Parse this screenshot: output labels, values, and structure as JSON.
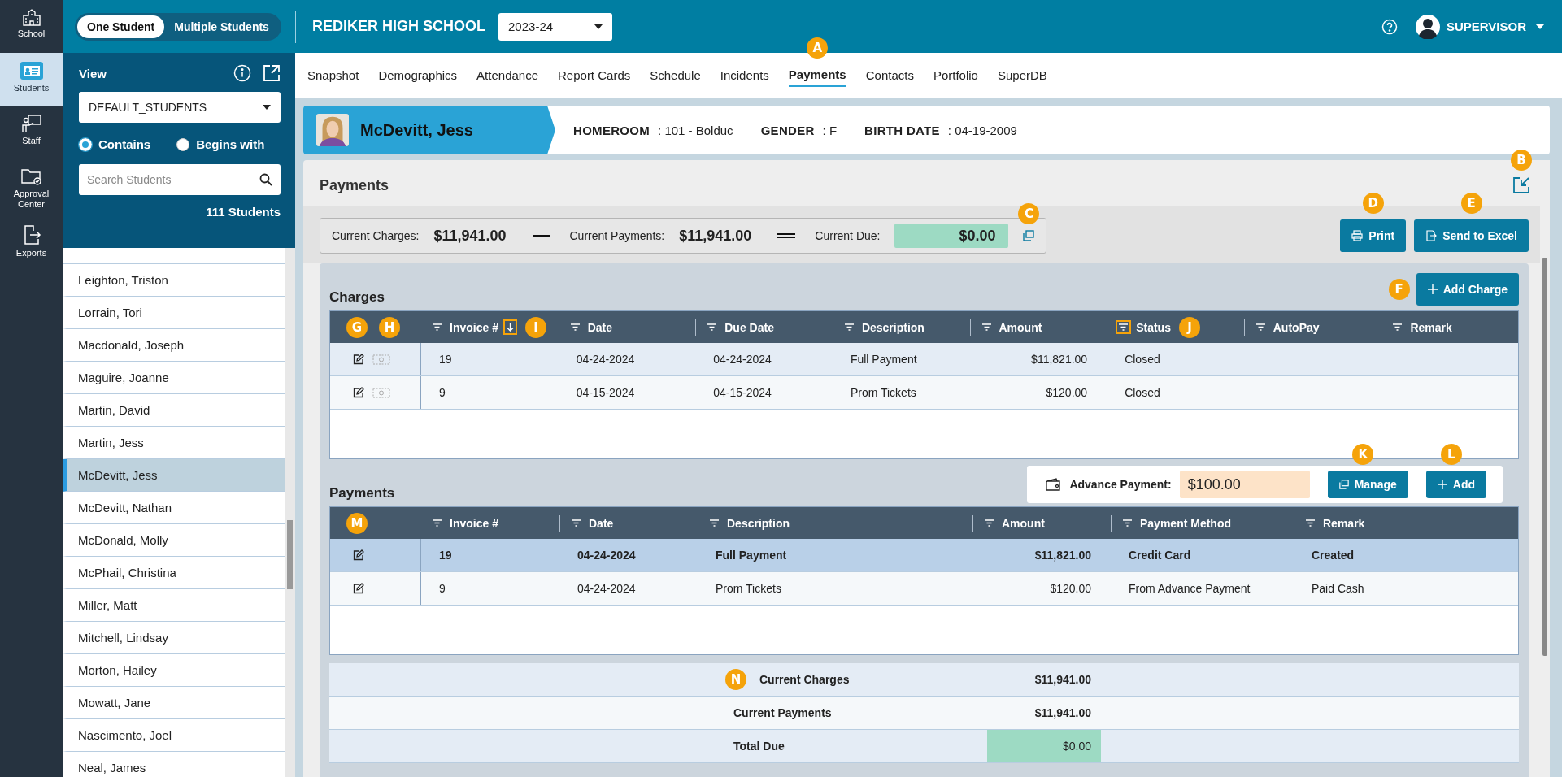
{
  "rail": [
    {
      "label": "School",
      "selected": false
    },
    {
      "label": "Students",
      "selected": true
    },
    {
      "label": "Staff",
      "selected": false
    },
    {
      "label": "Approval Center",
      "selected": false
    },
    {
      "label": "Exports",
      "selected": false
    }
  ],
  "mode_toggle": [
    {
      "label": "One Student",
      "selected": true
    },
    {
      "label": "Multiple Students",
      "selected": false
    }
  ],
  "school": "REDIKER HIGH SCHOOL",
  "year": "2023-24",
  "user": "SUPERVISOR",
  "sidebar": {
    "view_label": "View",
    "view_value": "DEFAULT_STUDENTS",
    "match": [
      {
        "label": "Contains",
        "selected": true
      },
      {
        "label": "Begins with",
        "selected": false
      }
    ],
    "search": {
      "placeholder": "Search Students"
    },
    "count": "111 Students",
    "students": [
      {
        "name": "Leighton, Triston",
        "selected": false
      },
      {
        "name": "Lorrain, Tori",
        "selected": false
      },
      {
        "name": "Macdonald, Joseph",
        "selected": false
      },
      {
        "name": "Maguire, Joanne",
        "selected": false
      },
      {
        "name": "Martin, David",
        "selected": false
      },
      {
        "name": "Martin, Jess",
        "selected": false
      },
      {
        "name": "McDevitt, Jess",
        "selected": true
      },
      {
        "name": "McDevitt, Nathan",
        "selected": false
      },
      {
        "name": "McDonald, Molly",
        "selected": false
      },
      {
        "name": "McPhail, Christina",
        "selected": false
      },
      {
        "name": "Miller, Matt",
        "selected": false
      },
      {
        "name": "Mitchell, Lindsay",
        "selected": false
      },
      {
        "name": "Morton, Hailey",
        "selected": false
      },
      {
        "name": "Mowatt, Jane",
        "selected": false
      },
      {
        "name": "Nascimento, Joel",
        "selected": false
      },
      {
        "name": "Neal, James",
        "selected": false
      }
    ]
  },
  "tabs": [
    {
      "label": "Snapshot",
      "selected": false
    },
    {
      "label": "Demographics",
      "selected": false
    },
    {
      "label": "Attendance",
      "selected": false
    },
    {
      "label": "Report Cards",
      "selected": false
    },
    {
      "label": "Schedule",
      "selected": false
    },
    {
      "label": "Incidents",
      "selected": false
    },
    {
      "label": "Payments",
      "selected": true,
      "callout": "A"
    },
    {
      "label": "Contacts",
      "selected": false
    },
    {
      "label": "Portfolio",
      "selected": false
    },
    {
      "label": "SuperDB",
      "selected": false
    }
  ],
  "student": {
    "name": "McDevitt, Jess",
    "fields": [
      {
        "label": "HOMEROOM",
        "value": ": 101 - Bolduc"
      },
      {
        "label": "GENDER",
        "value": ": F"
      },
      {
        "label": "BIRTH DATE",
        "value": ": 04-19-2009"
      }
    ]
  },
  "panel": {
    "title": "Payments",
    "popout_callout": "B"
  },
  "summary": {
    "charges_label": "Current Charges:",
    "charges": "$11,941.00",
    "payments_label": "Current Payments:",
    "payments": "$11,941.00",
    "due_label": "Current Due:",
    "due": "$0.00",
    "copy_callout": "C"
  },
  "buttons": [
    {
      "label": "Print",
      "callout": "D"
    },
    {
      "label": "Send to Excel",
      "callout": "E"
    }
  ],
  "charges": {
    "title": "Charges",
    "add_button": {
      "label": "Add Charge",
      "callout": "F"
    },
    "action_callouts": [
      "G",
      "H"
    ],
    "columns": [
      {
        "label": "Invoice #",
        "sorted": true,
        "highlighted": true,
        "callout": "I"
      },
      {
        "label": "Date",
        "sorted": false,
        "highlighted": false
      },
      {
        "label": "Due Date",
        "sorted": false,
        "highlighted": false
      },
      {
        "label": "Description",
        "sorted": false,
        "highlighted": false
      },
      {
        "label": "Amount",
        "sorted": false,
        "highlighted": false
      },
      {
        "label": "Status",
        "sorted": false,
        "highlighted": true,
        "callout": "J"
      },
      {
        "label": "AutoPay",
        "sorted": false,
        "highlighted": false
      },
      {
        "label": "Remark",
        "sorted": false,
        "highlighted": false
      }
    ],
    "rows": [
      {
        "cells": [
          "19",
          "04-24-2024",
          "04-24-2024",
          "Full Payment",
          "$11,821.00",
          "Closed"
        ]
      },
      {
        "cells": [
          "9",
          "04-15-2024",
          "04-15-2024",
          "Prom Tickets",
          "$120.00",
          "Closed"
        ]
      }
    ]
  },
  "payments": {
    "title": "Payments",
    "advance_label": "Advance Payment:",
    "advance_value": "$100.00",
    "buttons": [
      {
        "label": "Manage",
        "callout": "K"
      },
      {
        "label": "Add",
        "callout": "L"
      }
    ],
    "action_callouts": [
      "M"
    ],
    "columns": [
      {
        "label": "Invoice #"
      },
      {
        "label": "Date"
      },
      {
        "label": "Description"
      },
      {
        "label": "Amount"
      },
      {
        "label": "Payment Method"
      },
      {
        "label": "Remark"
      }
    ],
    "rows": [
      {
        "cells": [
          "19",
          "04-24-2024",
          "Full Payment",
          "$11,821.00",
          "Credit Card",
          "Created"
        ],
        "selected": true
      },
      {
        "cells": [
          "9",
          "04-24-2024",
          "Prom Tickets",
          "$120.00",
          "From Advance Payment",
          "Paid Cash"
        ],
        "selected": false
      }
    ]
  },
  "totals": [
    {
      "label": "Current Charges",
      "value": "$11,941.00",
      "kind": "plain",
      "callout": "N"
    },
    {
      "label": "Current Payments",
      "value": "$11,941.00",
      "kind": "plain"
    },
    {
      "label": "Total Due",
      "value": "$0.00",
      "kind": "due"
    }
  ]
}
